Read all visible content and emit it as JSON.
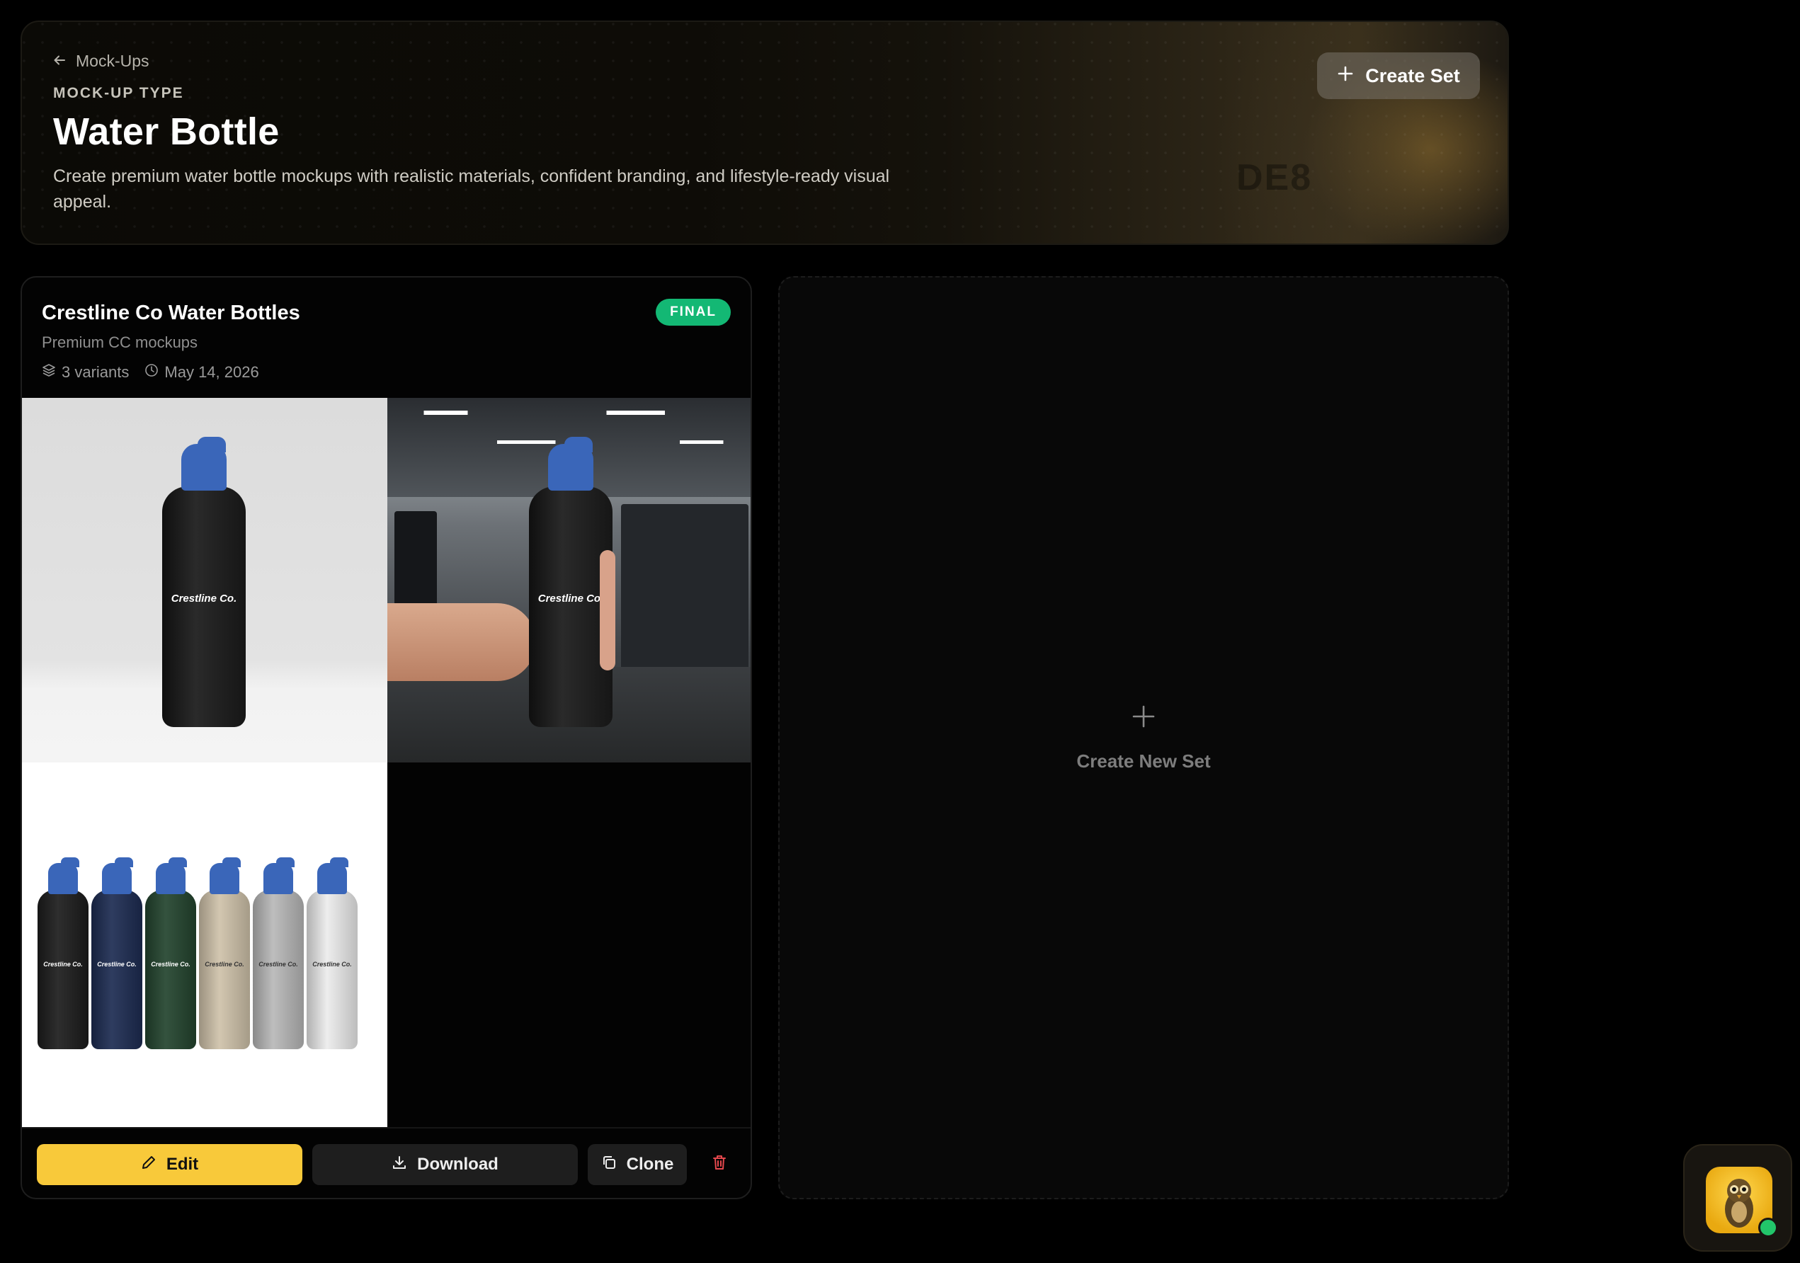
{
  "hero": {
    "back_label": "Mock-Ups",
    "eyebrow": "MOCK-UP TYPE",
    "title": "Water Bottle",
    "description": "Create premium water bottle mockups with realistic materials, confident branding, and lifestyle-ready visual appeal.",
    "create_button": "Create Set",
    "background_logo_text": "DE8"
  },
  "set_card": {
    "title": "Crestline Co Water Bottles",
    "subtitle": "Premium CC mockups",
    "status_badge": "FINAL",
    "variants_text": "3 variants",
    "date_text": "May 14, 2026",
    "images": [
      {
        "name": "studio-black-bottle",
        "brand_text": "Crestline Co."
      },
      {
        "name": "gym-hand-held-bottle",
        "brand_text": "Crestline Co."
      },
      {
        "name": "six-color-bottle-lineup",
        "brand_text": "Crestline Co."
      }
    ],
    "lineup_colors": [
      "#1c1c1c",
      "#1d2c52",
      "#23442e",
      "#cfc2aa",
      "#b8b8b8",
      "#ececec"
    ],
    "actions": {
      "edit": "Edit",
      "download": "Download",
      "clone": "Clone"
    }
  },
  "new_set": {
    "label": "Create New Set"
  },
  "colors": {
    "badge_green": "#13b874",
    "edit_yellow": "#f8c93a",
    "delete_red": "#e5484d",
    "cap_blue": "#3a66b9",
    "status_green": "#22c56a"
  }
}
